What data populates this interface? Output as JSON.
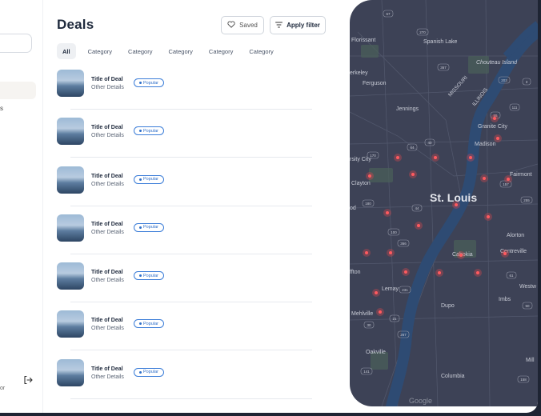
{
  "sidebar": {
    "partial_letter": "s",
    "footer_text": "or"
  },
  "header": {
    "title": "Deals",
    "saved_label": "Saved",
    "filter_label": "Apply filter"
  },
  "tabs": [
    {
      "label": "All",
      "active": true
    },
    {
      "label": "Category",
      "active": false
    },
    {
      "label": "Category",
      "active": false
    },
    {
      "label": "Category",
      "active": false
    },
    {
      "label": "Category",
      "active": false
    },
    {
      "label": "Category",
      "active": false
    }
  ],
  "deals": [
    {
      "title": "Title of Deal",
      "details": "Other Details",
      "badge": "Popular"
    },
    {
      "title": "Title of Deal",
      "details": "Other Details",
      "badge": "Popular"
    },
    {
      "title": "Title of Deal",
      "details": "Other Details",
      "badge": "Popular"
    },
    {
      "title": "Title of Deal",
      "details": "Other Details",
      "badge": "Popular"
    },
    {
      "title": "Title of Deal",
      "details": "Other Details",
      "badge": "Popular"
    },
    {
      "title": "Title of Deal",
      "details": "Other Details",
      "badge": "Popular"
    },
    {
      "title": "Title of Deal",
      "details": "Other Details",
      "badge": "Popular"
    }
  ],
  "map": {
    "city_label": "St. Louis",
    "attribution": "Google",
    "place_labels": [
      "Florissant",
      "Spanish Lake",
      "Chouteau Island",
      "erkeley",
      "Ferguson",
      "Jennings",
      "MISSOURI",
      "ILLINOIS",
      "Granite City",
      "Madison",
      "rsity City",
      "Clayton",
      "Fairmont",
      "od",
      "Alorton",
      "Centreville",
      "ffton",
      "Cahokia",
      "Lemay",
      "Mehlville",
      "Dupo",
      "Imbs",
      "Westw",
      "Oakville",
      "Columbia",
      "Mill"
    ],
    "route_numbers": [
      "67",
      "270",
      "367",
      "203",
      "3",
      "111",
      "55",
      "40",
      "64",
      "157",
      "255",
      "170",
      "180",
      "100",
      "366",
      "44",
      "231",
      "21",
      "30",
      "267",
      "141",
      "61",
      "50",
      "158"
    ]
  },
  "colors": {
    "accent": "#2f6fc9",
    "map_background": "#3d4256",
    "marker": "#e0474c"
  }
}
